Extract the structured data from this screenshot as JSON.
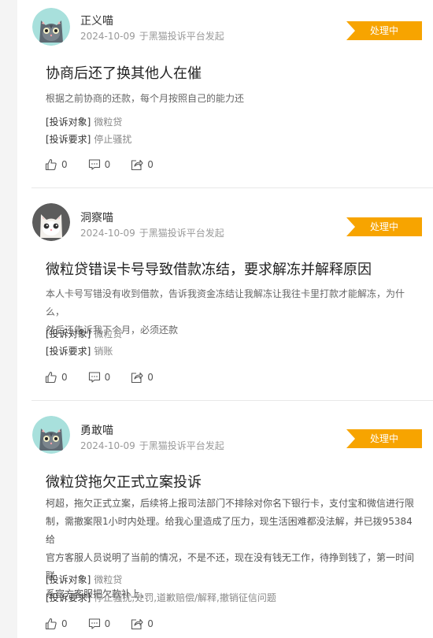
{
  "colors": {
    "status": "#f7a400",
    "accent_text": "#999999"
  },
  "icons": {
    "like": "thumbs-up-icon",
    "comment": "comment-icon",
    "share": "share-icon"
  },
  "complaints": [
    {
      "username": "正义喵",
      "avatar": "gray-cat-avatar",
      "date": "2024-10-09",
      "source": "于黑猫投诉平台发起",
      "status": "处理中",
      "title": "协商后还了换其他人在催",
      "description_lines": [
        "根据之前协商的还款，每个月按照自己的能力还"
      ],
      "target_label": "[投诉对象]",
      "target": "微粒贷",
      "demand_label": "[投诉要求]",
      "demand": "停止骚扰",
      "likes": "0",
      "comments": "0",
      "shares": "0"
    },
    {
      "username": "洞察喵",
      "avatar": "white-cat-avatar",
      "date": "2024-10-09",
      "source": "于黑猫投诉平台发起",
      "status": "处理中",
      "title": "微粒贷错误卡号导致借款冻结，要求解冻并解释原因",
      "description_lines": [
        "本人卡号写错没有收到借款，告诉我资金冻结让我解冻让我往卡里打款才能解冻，为什么，",
        "然后还告诉我下个月，必须还款"
      ],
      "target_label": "[投诉对象]",
      "target": "微粒贷",
      "demand_label": "[投诉要求]",
      "demand": "销账",
      "likes": "0",
      "comments": "0",
      "shares": "0"
    },
    {
      "username": "勇敢喵",
      "avatar": "gray-cat-avatar",
      "date": "2024-10-09",
      "source": "于黑猫投诉平台发起",
      "status": "处理中",
      "title": "微粒贷拖欠正式立案投诉",
      "description_lines": [
        "柯超，拖欠正式立案，后续将上报司法部门不排除对你名下银行卡，支付宝和微信进行限",
        "制，需撤案限1小时内处理。给我心里造成了压力，现生活困难都没法解，并已拨95384给",
        "官方客服人员说明了当前的情况，不是不还，现在没有钱无工作，待挣到钱了，第一时间联",
        "系官方客服把欠款补上。"
      ],
      "target_label": "[投诉对象]",
      "target": "微粒贷",
      "demand_label": "[投诉要求]",
      "demand": "停止骚扰,处罚,道歉赔偿/解释,撤销征信问题",
      "likes": "0",
      "comments": "0",
      "shares": "0"
    }
  ]
}
